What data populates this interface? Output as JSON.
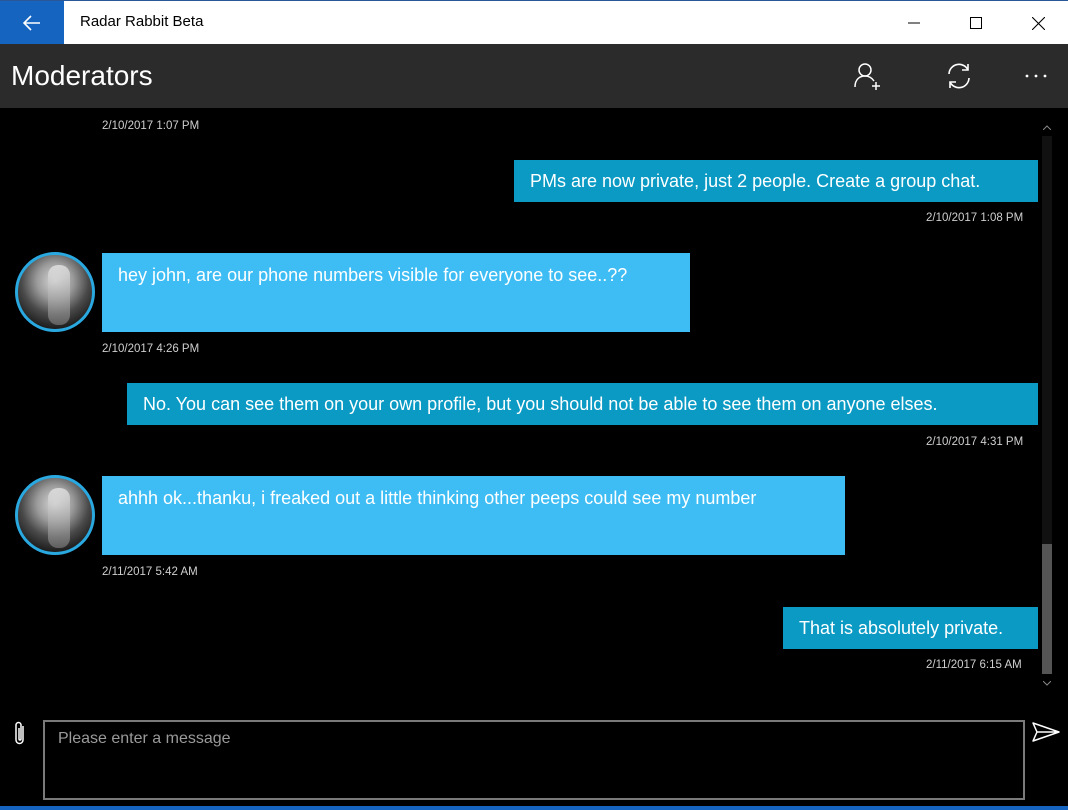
{
  "window": {
    "app_title": "Radar Rabbit Beta",
    "accent": "#1565c0"
  },
  "header": {
    "title": "Moderators",
    "icons": [
      "add-user-icon",
      "refresh-icon",
      "more-icon"
    ]
  },
  "messages": [
    {
      "type": "timestamp-only",
      "timestamp": "2/10/2017 1:07 PM"
    },
    {
      "type": "sent",
      "text": "PMs are now private, just 2 people. Create a group chat.",
      "timestamp": "2/10/2017 1:08 PM"
    },
    {
      "type": "received",
      "text": "hey john, are our phone numbers visible for everyone to see..??",
      "timestamp": "2/10/2017 4:26 PM"
    },
    {
      "type": "sent",
      "text": "No. You can see them on your own profile, but you should not be able to see them on anyone elses.",
      "timestamp": "2/10/2017 4:31 PM"
    },
    {
      "type": "received",
      "text": "ahhh ok...thanku, i freaked out a little thinking other peeps could see my number",
      "timestamp": "2/11/2017 5:42 AM"
    },
    {
      "type": "sent",
      "text": "That is absolutely private.",
      "timestamp": "2/11/2017 6:15 AM"
    }
  ],
  "composer": {
    "placeholder": "Please enter a message",
    "value": ""
  },
  "colors": {
    "sent_bubble": "#0a9ac4",
    "received_bubble": "#3ebdf5",
    "header_bg": "#2b2b2b"
  }
}
